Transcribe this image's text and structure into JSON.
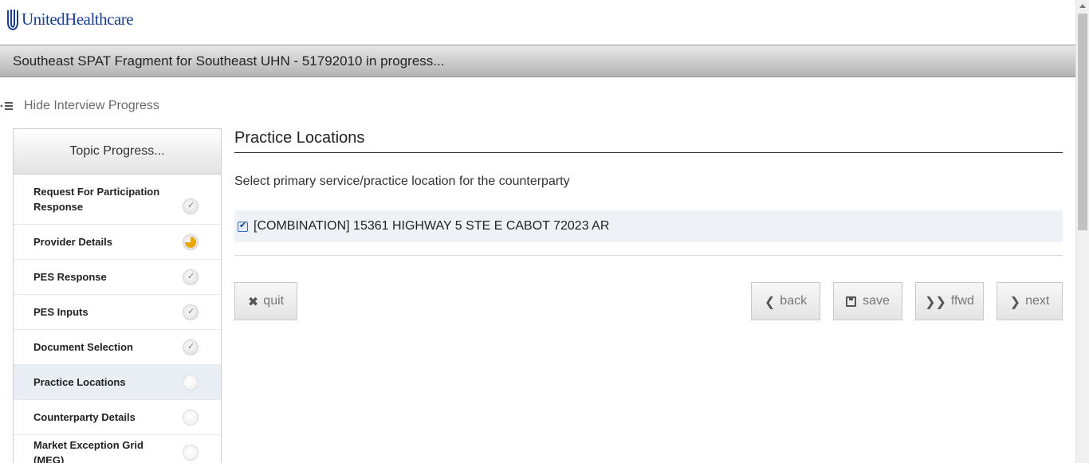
{
  "brand": {
    "name": "UnitedHealthcare"
  },
  "title_bar": {
    "text": "Southeast SPAT Fragment for Southeast UHN - 51792010 in progress..."
  },
  "hide_progress": {
    "label": "Hide Interview Progress",
    "icon": "collapse-menu-icon"
  },
  "sidebar": {
    "header": "Topic Progress...",
    "topics": [
      {
        "label": "Request For Participation Response",
        "status": "complete"
      },
      {
        "label": "Provider Details",
        "status": "in-progress"
      },
      {
        "label": "PES Response",
        "status": "complete"
      },
      {
        "label": "PES Inputs",
        "status": "complete"
      },
      {
        "label": "Document Selection",
        "status": "complete"
      },
      {
        "label": "Practice Locations",
        "status": "not-started",
        "active": true
      },
      {
        "label": "Counterparty Details",
        "status": "not-started"
      },
      {
        "label": "Market Exception Grid (MEG)",
        "status": "not-started"
      }
    ]
  },
  "main": {
    "section_title": "Practice Locations",
    "question": "Select primary service/practice location for the counterparty",
    "options": [
      {
        "label": "[COMBINATION] 15361 HIGHWAY 5 STE E CABOT 72023 AR",
        "checked": true
      }
    ]
  },
  "buttons": {
    "quit": {
      "label": "quit",
      "icon": "close-icon"
    },
    "back": {
      "label": "back",
      "icon": "chevron-left-icon"
    },
    "save": {
      "label": "save",
      "icon": "floppy-disk-icon"
    },
    "ffwd": {
      "label": "ffwd",
      "icon": "double-chevron-right-icon"
    },
    "next": {
      "label": "next",
      "icon": "chevron-right-icon"
    }
  },
  "colors": {
    "brand_blue": "#1b3f8f",
    "progress_yellow": "#e9a800",
    "active_row": "#e9eef5"
  }
}
